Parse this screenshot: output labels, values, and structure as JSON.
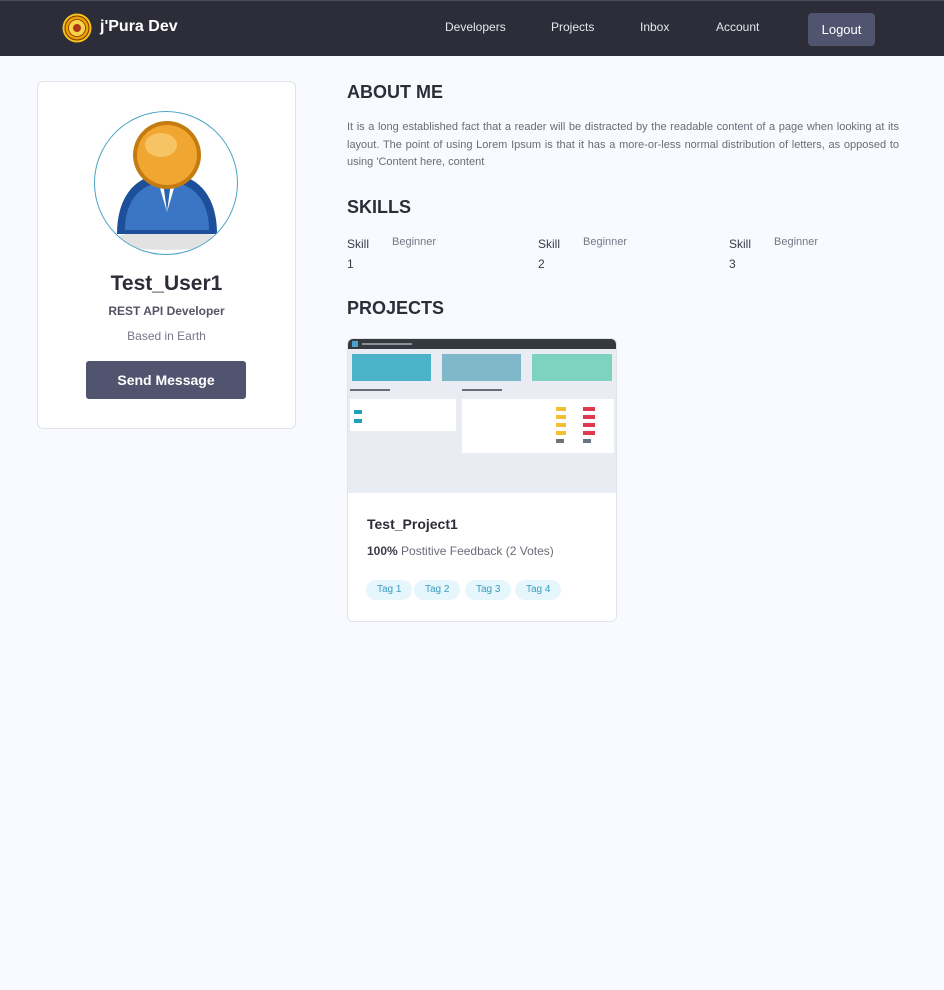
{
  "header": {
    "brand": "j'Pura Dev",
    "nav": [
      "Developers",
      "Projects",
      "Inbox",
      "Account"
    ],
    "logout_label": "Logout",
    "logo_icon": "university-seal-icon"
  },
  "profile": {
    "name": "Test_User1",
    "role": "REST API Developer",
    "location": "Based in Earth",
    "send_message_label": "Send Message",
    "avatar_icon": "user-avatar-icon"
  },
  "about": {
    "title": "ABOUT ME",
    "text": "It is a long established fact that a reader will be distracted by the readable content of a page when looking at its layout. The point of using Lorem Ipsum is that it has a more-or-less normal distribution of letters, as opposed to using 'Content here, content"
  },
  "skills": {
    "title": "SKILLS",
    "items": [
      {
        "name": "Skill 1",
        "level": "Beginner"
      },
      {
        "name": "Skill 2",
        "level": "Beginner"
      },
      {
        "name": "Skill 3",
        "level": "Beginner"
      }
    ]
  },
  "projects": {
    "title": "PROJECTS",
    "items": [
      {
        "title": "Test_Project1",
        "feedback_percent": "100%",
        "feedback_text": "Postitive Feedback (2 Votes)",
        "tags": [
          "Tag 1",
          "Tag 2",
          "Tag 3",
          "Tag 4"
        ]
      }
    ]
  },
  "colors": {
    "header_bg": "#2d2d39",
    "button_bg": "#51546e",
    "page_bg": "#f8faff",
    "tag_bg": "#e5f6fc",
    "tag_text": "#3a9cc0"
  }
}
